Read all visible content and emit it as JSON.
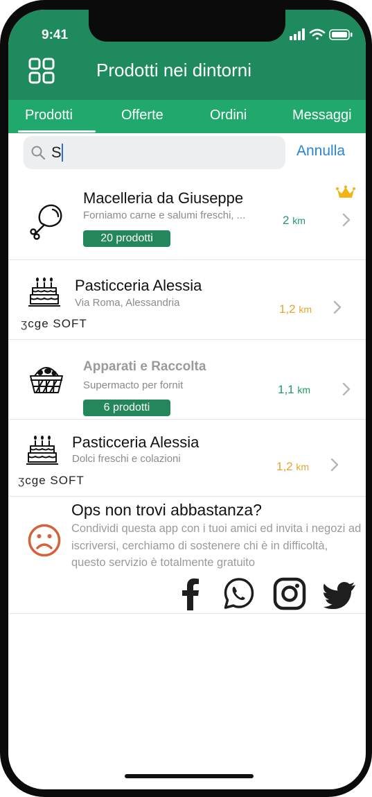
{
  "status_bar": {
    "time": "9:41"
  },
  "header": {
    "title": "Prodotti nei dintorni",
    "menu_icon": "grid-icon"
  },
  "tabs": [
    {
      "label": "Prodotti",
      "active": true
    },
    {
      "label": "Offerte"
    },
    {
      "label": "Ordini"
    },
    {
      "label": "Messaggi"
    }
  ],
  "search": {
    "value": "S",
    "cancel_label": "Annulla"
  },
  "shops": [
    {
      "name": "Macelleria da Giuseppe",
      "description": "Forniamo carne e salumi freschi, ...",
      "badge": "20 prodotti",
      "distance": "2",
      "unit": "km",
      "distance_color": "#1f9a66",
      "icon": "chicken-leg-icon",
      "premium": true
    },
    {
      "name": "Pasticceria Alessia",
      "description": "Via Roma, Alessandria",
      "distance": "1,2",
      "unit": "km",
      "distance_color": "#e7a32b",
      "icon": "cake-icon",
      "brand": "cge SOFT"
    },
    {
      "name": "Apparati e Raccolta",
      "description": "Supermacto per fornit",
      "badge": "6 prodotti",
      "distance": "1,1",
      "unit": "km",
      "distance_color": "#1f9a66",
      "icon": "basket-icon"
    },
    {
      "name": "Pasticceria Alessia",
      "description": "Dolci freschi e colazioni",
      "distance": "1,2",
      "unit": "km",
      "distance_color": "#e7a32b",
      "icon": "cake-icon",
      "brand": "cge SOFT"
    }
  ],
  "empty_state": {
    "title": "Ops non trovi abbastanza?",
    "message": "Condividi questa app con i tuoi amici ed invita i negozi ad iscriversi, cerchiamo di sostenere chi è in difficoltà, questo servizio è totalmente gratuito",
    "share_icons": [
      "facebook-icon",
      "whatsapp-icon",
      "instagram-icon",
      "twitter-icon"
    ]
  },
  "colors": {
    "header_green": "#1f8a5e",
    "tab_green": "#21a86c",
    "badge_green": "#24875b",
    "link_blue": "#2585d8",
    "sad_face": "#d4623a"
  }
}
